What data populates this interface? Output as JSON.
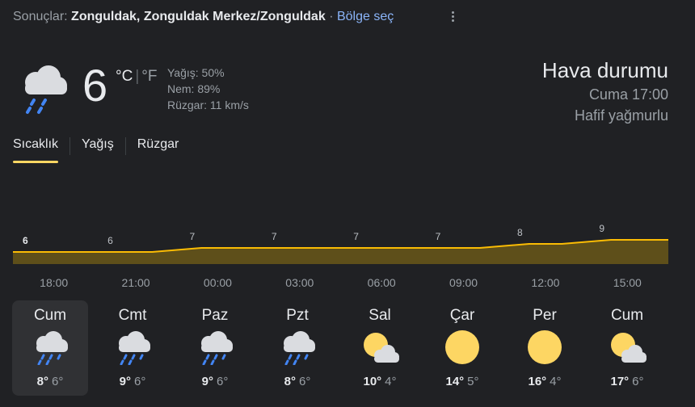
{
  "header": {
    "results_label": "Sonuçlar:",
    "location": "Zonguldak, Zonguldak Merkez/Zonguldak",
    "separator": "·",
    "region_link": "Bölge seç"
  },
  "current": {
    "temperature": "6",
    "unit_c": "°C",
    "unit_sep": "|",
    "unit_f": "°F",
    "precip": "Yağış: 50%",
    "humidity": "Nem: 89%",
    "wind": "Rüzgar: 11 km/s",
    "icon": "rain-cloud-icon"
  },
  "summary": {
    "title": "Hava durumu",
    "time": "Cuma 17:00",
    "condition": "Hafif yağmurlu"
  },
  "tabs": [
    {
      "label": "Sıcaklık",
      "active": true
    },
    {
      "label": "Yağış",
      "active": false
    },
    {
      "label": "Rüzgar",
      "active": false
    }
  ],
  "colors": {
    "accent": "#fdd663",
    "line": "#fbbc04",
    "fill": "#5e4f1a",
    "background": "#202124"
  },
  "chart_data": {
    "type": "area",
    "x": [
      "18:00",
      "21:00",
      "00:00",
      "03:00",
      "06:00",
      "09:00",
      "12:00",
      "15:00"
    ],
    "values": [
      6,
      6,
      7,
      7,
      7,
      7,
      8,
      9
    ],
    "ylim": [
      5,
      10
    ]
  },
  "days": [
    {
      "name": "Cum",
      "hi": "8°",
      "lo": "6°",
      "icon": "rain-cloud-icon",
      "selected": true
    },
    {
      "name": "Cmt",
      "hi": "9°",
      "lo": "6°",
      "icon": "rain-cloud-icon",
      "selected": false
    },
    {
      "name": "Paz",
      "hi": "9°",
      "lo": "6°",
      "icon": "rain-cloud-icon",
      "selected": false
    },
    {
      "name": "Pzt",
      "hi": "8°",
      "lo": "6°",
      "icon": "rain-cloud-icon",
      "selected": false
    },
    {
      "name": "Sal",
      "hi": "10°",
      "lo": "4°",
      "icon": "partly-sunny-icon",
      "selected": false
    },
    {
      "name": "Çar",
      "hi": "14°",
      "lo": "5°",
      "icon": "sun-icon",
      "selected": false
    },
    {
      "name": "Per",
      "hi": "16°",
      "lo": "4°",
      "icon": "sun-icon",
      "selected": false
    },
    {
      "name": "Cum",
      "hi": "17°",
      "lo": "6°",
      "icon": "partly-sunny-icon",
      "selected": false
    }
  ]
}
